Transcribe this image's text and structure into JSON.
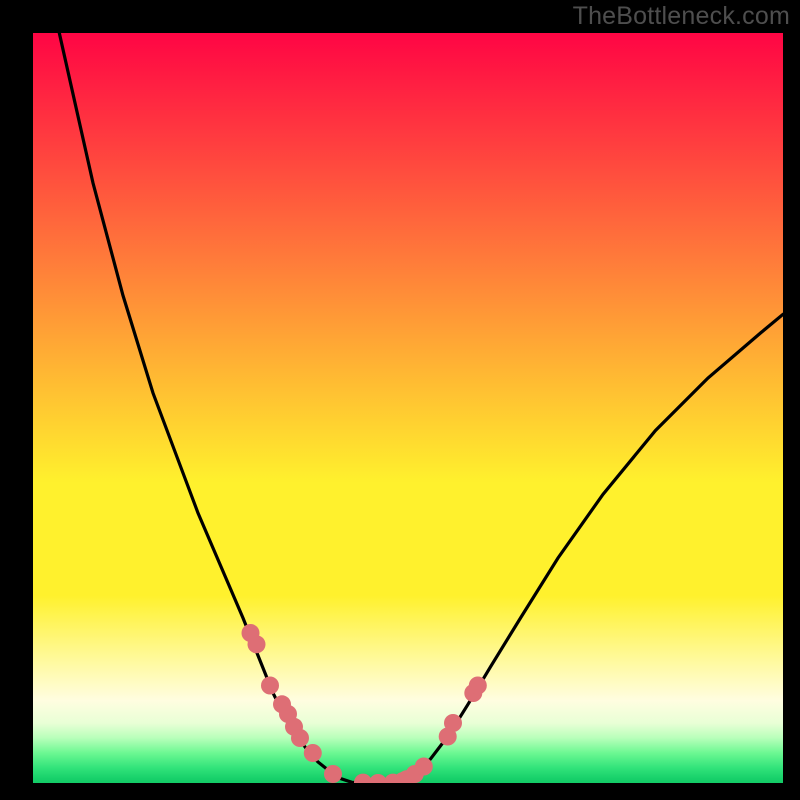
{
  "watermark": "TheBottleneck.com",
  "colors": {
    "frame": "#000000",
    "curve": "#000000",
    "dot": "#de6e75"
  },
  "chart_data": {
    "type": "line",
    "title": "",
    "xlabel": "",
    "ylabel": "",
    "xlim": [
      0,
      100
    ],
    "ylim": [
      0,
      100
    ],
    "grid": false,
    "series": [
      {
        "name": "left-curve",
        "x": [
          3.5,
          8,
          12,
          16,
          19,
          22,
          25,
          28,
          30,
          32,
          33.5,
          35,
          36.5,
          38,
          39.5,
          41,
          42.5
        ],
        "y": [
          100,
          80,
          65,
          52,
          44,
          36,
          29,
          22,
          17,
          12,
          9,
          6.5,
          4.5,
          2.8,
          1.6,
          0.6,
          0.1
        ]
      },
      {
        "name": "trough",
        "x": [
          42.5,
          46,
          49
        ],
        "y": [
          0.1,
          0.0,
          0.2
        ]
      },
      {
        "name": "right-curve",
        "x": [
          49,
          51,
          53,
          55.5,
          58,
          61,
          65,
          70,
          76,
          83,
          90,
          97,
          100
        ],
        "y": [
          0.2,
          1.2,
          3.2,
          6.5,
          10.5,
          15.5,
          22,
          30,
          38.5,
          47,
          54,
          60,
          62.5
        ]
      }
    ],
    "markers": {
      "name": "highlight-dots",
      "x": [
        29.0,
        29.8,
        31.6,
        33.2,
        34.0,
        34.8,
        35.6,
        37.3,
        40.0,
        44.0,
        46.0,
        48.0,
        49.3,
        49.8,
        50.9,
        52.1,
        55.3,
        56.0,
        58.7,
        59.3
      ],
      "y": [
        20.0,
        18.5,
        13.0,
        10.5,
        9.2,
        7.5,
        6.0,
        4.0,
        1.2,
        0.05,
        0.0,
        0.05,
        0.25,
        0.5,
        1.2,
        2.2,
        6.2,
        8.0,
        12.0,
        13.0
      ]
    },
    "background_gradient": [
      {
        "pos": 0.0,
        "color": "#ff0544"
      },
      {
        "pos": 0.15,
        "color": "#ff3f3f"
      },
      {
        "pos": 0.3,
        "color": "#ff7a3a"
      },
      {
        "pos": 0.45,
        "color": "#ffb633"
      },
      {
        "pos": 0.6,
        "color": "#fff12d"
      },
      {
        "pos": 0.82,
        "color": "#fff888"
      },
      {
        "pos": 0.92,
        "color": "#e9ffd6"
      },
      {
        "pos": 0.96,
        "color": "#6cf892"
      },
      {
        "pos": 1.0,
        "color": "#14cb67"
      }
    ]
  }
}
